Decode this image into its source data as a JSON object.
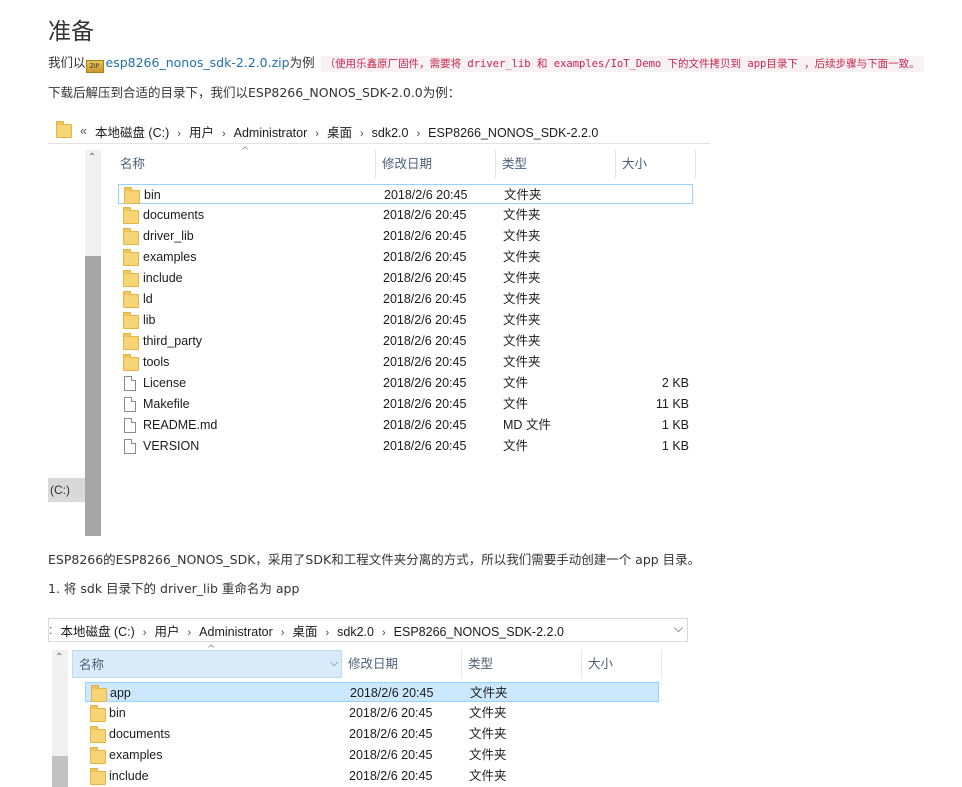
{
  "title": "准备",
  "intro": {
    "prefix": "我们以",
    "zip_icon_text": "ZIP",
    "link": "esp8266_nonos_sdk-2.2.0.zip",
    "suffix": "为例",
    "note": "（使用乐鑫原厂固件，需要将 driver_lib 和 examples/IoT_Demo 下的文件拷贝到 app目录下 ，后续步骤与下面一致。"
  },
  "line2": "下载后解压到合适的目录下，我们以ESP8266_NONOS_SDK-2.0.0为例：",
  "explorer1": {
    "breadcrumb_lead": "«",
    "breadcrumb": [
      "本地磁盘 (C:)",
      "用户",
      "Administrator",
      "桌面",
      "sdk2.0",
      "ESP8266_NONOS_SDK-2.2.0"
    ],
    "columns": [
      "名称",
      "修改日期",
      "类型",
      "大小"
    ],
    "sidebar_item": "(C:)",
    "rows": [
      {
        "icon": "folder",
        "name": "bin",
        "date": "2018/2/6 20:45",
        "type": "文件夹",
        "size": ""
      },
      {
        "icon": "folder",
        "name": "documents",
        "date": "2018/2/6 20:45",
        "type": "文件夹",
        "size": ""
      },
      {
        "icon": "folder",
        "name": "driver_lib",
        "date": "2018/2/6 20:45",
        "type": "文件夹",
        "size": ""
      },
      {
        "icon": "folder",
        "name": "examples",
        "date": "2018/2/6 20:45",
        "type": "文件夹",
        "size": ""
      },
      {
        "icon": "folder",
        "name": "include",
        "date": "2018/2/6 20:45",
        "type": "文件夹",
        "size": ""
      },
      {
        "icon": "folder",
        "name": "ld",
        "date": "2018/2/6 20:45",
        "type": "文件夹",
        "size": ""
      },
      {
        "icon": "folder",
        "name": "lib",
        "date": "2018/2/6 20:45",
        "type": "文件夹",
        "size": ""
      },
      {
        "icon": "folder",
        "name": "third_party",
        "date": "2018/2/6 20:45",
        "type": "文件夹",
        "size": ""
      },
      {
        "icon": "folder",
        "name": "tools",
        "date": "2018/2/6 20:45",
        "type": "文件夹",
        "size": ""
      },
      {
        "icon": "file",
        "name": "License",
        "date": "2018/2/6 20:45",
        "type": "文件",
        "size": "2 KB"
      },
      {
        "icon": "file",
        "name": "Makefile",
        "date": "2018/2/6 20:45",
        "type": "文件",
        "size": "11 KB"
      },
      {
        "icon": "file",
        "name": "README.md",
        "date": "2018/2/6 20:45",
        "type": "MD 文件",
        "size": "1 KB"
      },
      {
        "icon": "file",
        "name": "VERSION",
        "date": "2018/2/6 20:45",
        "type": "文件",
        "size": "1 KB"
      }
    ]
  },
  "para1": "ESP8266的ESP8266_NONOS_SDK，采用了SDK和工程文件夹分离的方式，所以我们需要手动创建一个 app 目录。",
  "para2": "1. 将 sdk 目录下的 driver_lib 重命名为 app",
  "explorer2": {
    "breadcrumb_lead": ":",
    "breadcrumb": [
      "本地磁盘 (C:)",
      "用户",
      "Administrator",
      "桌面",
      "sdk2.0",
      "ESP8266_NONOS_SDK-2.2.0"
    ],
    "columns": [
      "名称",
      "修改日期",
      "类型",
      "大小"
    ],
    "rows": [
      {
        "icon": "folder",
        "name": "app",
        "date": "2018/2/6 20:45",
        "type": "文件夹",
        "size": ""
      },
      {
        "icon": "folder",
        "name": "bin",
        "date": "2018/2/6 20:45",
        "type": "文件夹",
        "size": ""
      },
      {
        "icon": "folder",
        "name": "documents",
        "date": "2018/2/6 20:45",
        "type": "文件夹",
        "size": ""
      },
      {
        "icon": "folder",
        "name": "examples",
        "date": "2018/2/6 20:45",
        "type": "文件夹",
        "size": ""
      },
      {
        "icon": "folder",
        "name": "include",
        "date": "2018/2/6 20:45",
        "type": "文件夹",
        "size": ""
      }
    ]
  }
}
